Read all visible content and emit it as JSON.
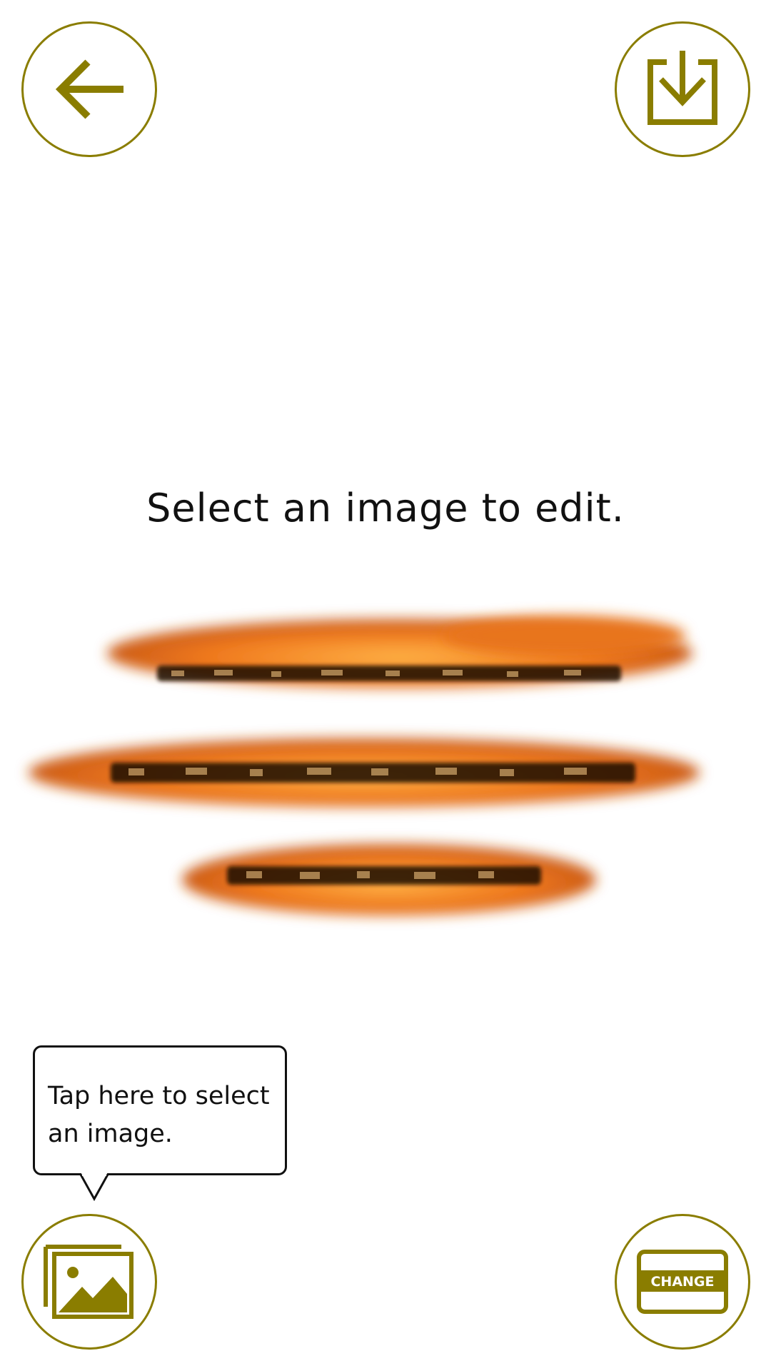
{
  "colors": {
    "accent": "#8a7d00",
    "text": "#111111",
    "background": "#ffffff",
    "brush_orange": "#e8741c",
    "brush_dark": "#1a0a00"
  },
  "header": {
    "back_button": {
      "icon": "arrow-left-icon"
    },
    "download_button": {
      "icon": "download-icon"
    }
  },
  "main": {
    "prompt": "Select an image to edit."
  },
  "tooltip": {
    "text": "Tap here to select an image."
  },
  "footer": {
    "gallery_button": {
      "icon": "image-gallery-icon"
    },
    "change_button": {
      "icon": "change-icon",
      "label": "CHANGE"
    }
  }
}
